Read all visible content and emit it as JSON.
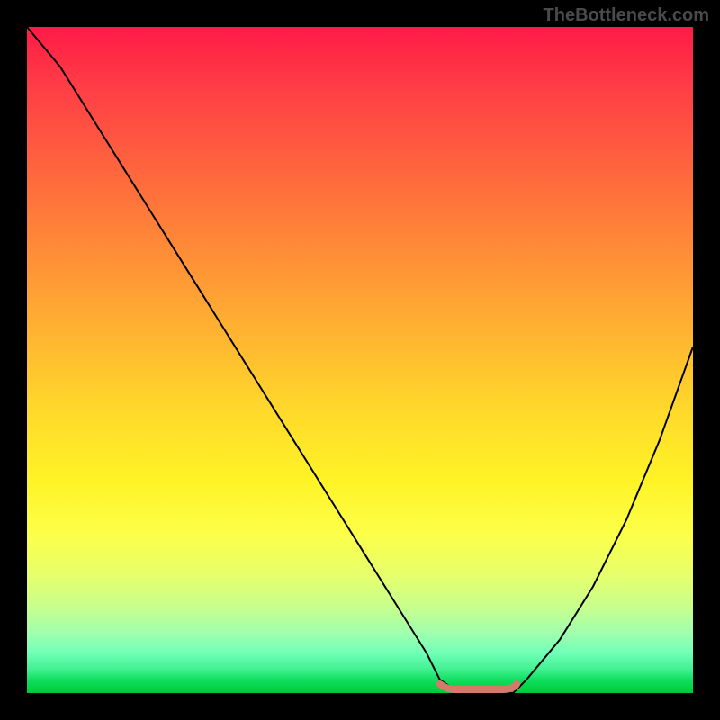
{
  "watermark": "TheBottleneck.com",
  "chart_data": {
    "type": "line",
    "title": "",
    "xlabel": "",
    "ylabel": "",
    "xlim": [
      0,
      100
    ],
    "ylim": [
      0,
      100
    ],
    "background": {
      "type": "vertical_gradient",
      "stops": [
        {
          "pos": 0,
          "color": "#ff1a47"
        },
        {
          "pos": 50,
          "color": "#ffda2b"
        },
        {
          "pos": 80,
          "color": "#fcff48"
        },
        {
          "pos": 100,
          "color": "#00c838"
        }
      ]
    },
    "series": [
      {
        "name": "bottleneck-curve",
        "color": "#000000",
        "x": [
          0,
          5,
          10,
          15,
          20,
          25,
          30,
          35,
          40,
          45,
          50,
          55,
          60,
          62,
          65,
          70,
          73,
          75,
          80,
          85,
          90,
          95,
          100
        ],
        "y": [
          100,
          94,
          86,
          78,
          70,
          62,
          54,
          46,
          38,
          30,
          22,
          14,
          6,
          2,
          0,
          0,
          0,
          2,
          8,
          16,
          26,
          38,
          52
        ]
      }
    ],
    "highlight": {
      "name": "optimal-segment",
      "color": "#d47a6a",
      "x_range": [
        62,
        73
      ],
      "y": 0
    }
  }
}
